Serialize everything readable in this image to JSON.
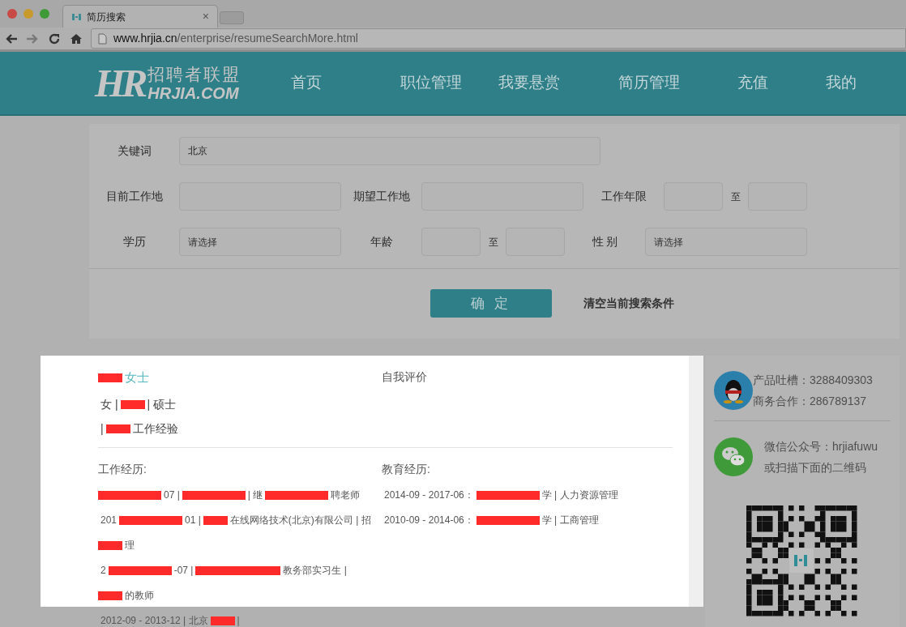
{
  "browser": {
    "tab_title": "简历搜索",
    "tab_close": "×",
    "url_host": "www.hrjia.cn",
    "url_path": "/enterprise/resumeSearchMore.html"
  },
  "header": {
    "logo": {
      "mark": "HR",
      "name": "招聘者联盟",
      "domain": "HRJIA.COM"
    },
    "nav": [
      {
        "label": "首页"
      },
      {
        "label": "职位管理"
      },
      {
        "label": "我要悬赏"
      },
      {
        "label": "简历管理"
      },
      {
        "label": "充值"
      },
      {
        "label": "我的"
      }
    ]
  },
  "search": {
    "rows": [
      {
        "fields": [
          {
            "label": "关键词",
            "kind": "keyword",
            "value": "北京"
          }
        ]
      },
      {
        "fields": [
          {
            "label": "目前工作地",
            "kind": "text"
          },
          {
            "label": "期望工作地",
            "kind": "text"
          },
          {
            "label": "工作年限",
            "kind": "range",
            "separator": "至"
          }
        ]
      },
      {
        "fields": [
          {
            "label": "学历",
            "kind": "select",
            "placeholder": "请选择"
          },
          {
            "label": "年龄",
            "kind": "range",
            "separator": "至"
          },
          {
            "label": "性 别",
            "kind": "select",
            "placeholder": "请选择"
          }
        ]
      }
    ],
    "submit": "确 定",
    "clear": "清空当前搜索条件"
  },
  "resume": {
    "name": [
      {
        "kind": "redacted_short"
      },
      {
        "kind": "text",
        "text": "女士"
      }
    ],
    "info_lines": [
      [
        {
          "kind": "text",
          "text": "女 |"
        },
        {
          "kind": "redacted_short"
        },
        {
          "kind": "text",
          "text": "| 硕士"
        }
      ],
      [
        {
          "kind": "text",
          "text": "|"
        },
        {
          "kind": "redacted_short"
        },
        {
          "kind": "text",
          "text": "工作经验"
        }
      ]
    ],
    "self_eval_title": "自我评价",
    "work_title": "工作经历:",
    "edu_title": "教育经历:",
    "work_lines": [
      [
        {
          "kind": "redacted"
        },
        {
          "kind": "text",
          "text": "07 |"
        },
        {
          "kind": "redacted"
        },
        {
          "kind": "text",
          "text": "| 继"
        },
        {
          "kind": "redacted"
        },
        {
          "kind": "text",
          "text": "聘老师"
        }
      ],
      [
        {
          "kind": "text",
          "text": "201"
        },
        {
          "kind": "redacted"
        },
        {
          "kind": "text",
          "text": "01 |"
        },
        {
          "kind": "redacted_short"
        },
        {
          "kind": "text",
          "text": "在线网络技术(北京)有限公司 | 招"
        }
      ],
      [
        {
          "kind": "redacted_short"
        },
        {
          "kind": "text",
          "text": "理"
        }
      ],
      [
        {
          "kind": "text",
          "text": "2"
        },
        {
          "kind": "redacted"
        },
        {
          "kind": "text",
          "text": "-07 |"
        },
        {
          "kind": "redacted_long"
        },
        {
          "kind": "text",
          "text": "教务部实习生 |"
        }
      ],
      [
        {
          "kind": "redacted_short"
        },
        {
          "kind": "text",
          "text": "的教师"
        }
      ],
      [
        {
          "kind": "text",
          "text": "2012-09 - 2013-12 | 北京"
        },
        {
          "kind": "redacted_short"
        },
        {
          "kind": "text",
          "text": "|"
        }
      ]
    ],
    "edu_lines": [
      [
        {
          "kind": "text",
          "text": "2014-09 - 2017-06："
        },
        {
          "kind": "redacted"
        },
        {
          "kind": "text",
          "text": "学 | 人力资源管理"
        }
      ],
      [
        {
          "kind": "text",
          "text": "2010-09 - 2014-06："
        },
        {
          "kind": "redacted"
        },
        {
          "kind": "text",
          "text": "学 | 工商管理"
        }
      ]
    ]
  },
  "sidebar": {
    "qq_lines": [
      "产品吐槽：3288409303",
      "商务合作：286789137"
    ],
    "wechat_lines": [
      "微信公众号：hrjiafuwu",
      "或扫描下面的二维码"
    ]
  }
}
